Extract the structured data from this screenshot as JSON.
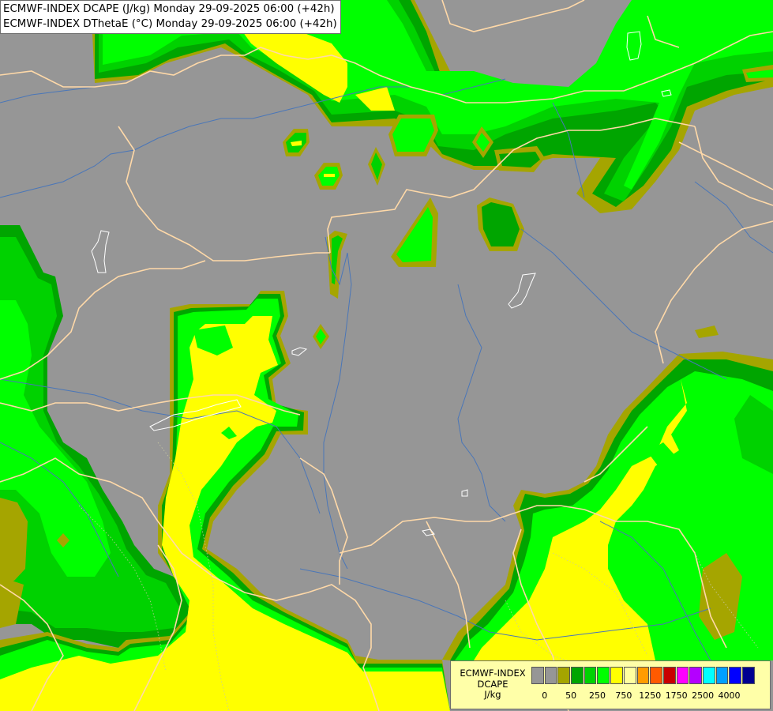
{
  "header": {
    "line1": "ECMWF-INDEX DCAPE (J/kg) Monday 29-09-2025 06:00 (+42h)",
    "line2": "ECMWF-INDEX DThetaE (°C) Monday 29-09-2025 06:00 (+42h)"
  },
  "legend": {
    "model": "ECMWF-INDEX",
    "field": "DCAPE",
    "unit": "J/kg",
    "swatch_colors": [
      "#969696",
      "#969696",
      "#a5a500",
      "#00a500",
      "#00d200",
      "#00ff00",
      "#ffff00",
      "#ffffa0",
      "#ff9c00",
      "#ff5a00",
      "#c80000",
      "#ff00ff",
      "#b400ff",
      "#00ffff",
      "#00a0ff",
      "#0000ff",
      "#000090"
    ],
    "ticks": [
      "0",
      "50",
      "250",
      "750",
      "1250",
      "1750",
      "2500",
      "4000"
    ]
  },
  "colors": {
    "background": "#969696",
    "olive": "#a5a500",
    "dark_green": "#00a500",
    "green": "#00d200",
    "light_green": "#00ff00",
    "yellow": "#ffff00",
    "borders": "#ffd9a8",
    "rivers": "#4a76b8",
    "lakes": "#ffffff"
  }
}
